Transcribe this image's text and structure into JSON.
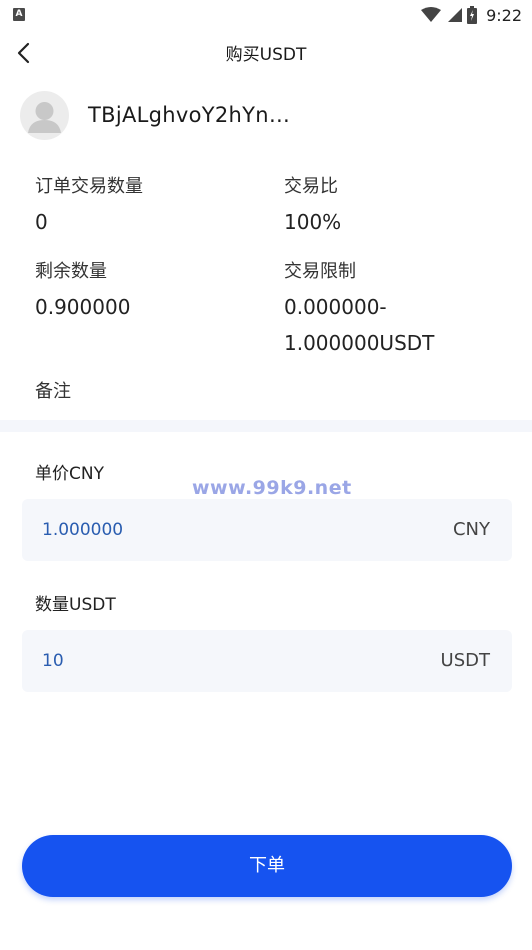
{
  "status_bar": {
    "time": "9:22"
  },
  "header": {
    "title": "购买USDT"
  },
  "seller": {
    "name": "TBjALghvoY2hYn…"
  },
  "info": {
    "order_qty_label": "订单交易数量",
    "order_qty_value": "0",
    "trade_ratio_label": "交易比",
    "trade_ratio_value": "100%",
    "remaining_label": "剩余数量",
    "remaining_value": "0.900000",
    "limit_label": "交易限制",
    "limit_value_line1": "0.000000-",
    "limit_value_line2": "1.000000USDT",
    "remark_label": "备注"
  },
  "form": {
    "price_label": "单价CNY",
    "price_value": "1.000000",
    "price_unit": "CNY",
    "qty_label": "数量USDT",
    "qty_value": "10",
    "qty_unit": "USDT"
  },
  "watermark": "www.99k9.net",
  "actions": {
    "place_order": "下单"
  },
  "colors": {
    "accent": "#1653f0",
    "input_text": "#2a5db0",
    "field_bg": "#f5f7fb"
  },
  "icons": [
    "app-notification-icon",
    "wifi-icon",
    "signal-icon",
    "battery-icon",
    "back-arrow-icon",
    "avatar-placeholder-icon"
  ]
}
